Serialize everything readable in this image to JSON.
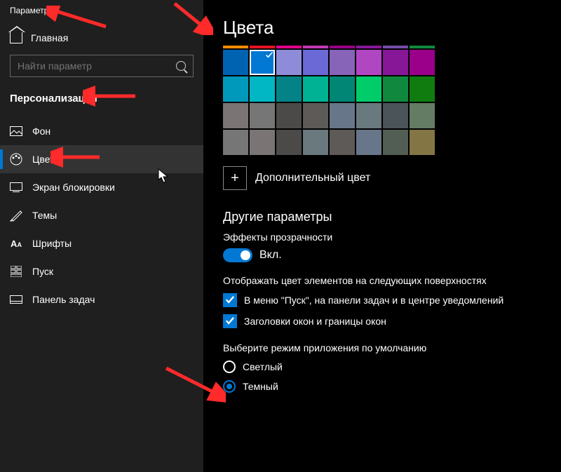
{
  "window_title": "Параметры",
  "home_label": "Главная",
  "search": {
    "placeholder": "Найти параметр"
  },
  "section_title": "Персонализация",
  "nav": [
    {
      "label": "Фон",
      "icon": "background"
    },
    {
      "label": "Цвета",
      "icon": "colors",
      "selected": true
    },
    {
      "label": "Экран блокировки",
      "icon": "lockscreen"
    },
    {
      "label": "Темы",
      "icon": "themes"
    },
    {
      "label": "Шрифты",
      "icon": "fonts"
    },
    {
      "label": "Пуск",
      "icon": "start"
    },
    {
      "label": "Панель задач",
      "icon": "taskbar"
    }
  ],
  "page_title": "Цвета",
  "recent_colors": [
    "#ff8c00",
    "#e81123",
    "#e3008c",
    "#c239b3",
    "#9a0089",
    "#881798",
    "#744da9",
    "#10893e"
  ],
  "color_palette": [
    [
      "#0063b1",
      "#0078d4",
      "#8e8cd8",
      "#6b69d6",
      "#8764b8",
      "#b146c2",
      "#881798",
      "#9a0089"
    ],
    [
      "#0099bc",
      "#00b7c3",
      "#038387",
      "#00b294",
      "#018574",
      "#00cc6a",
      "#10893e",
      "#107c10"
    ],
    [
      "#7a7574",
      "#767676",
      "#4c4a48",
      "#5d5a58",
      "#68768a",
      "#69797e",
      "#4a5459",
      "#647c64"
    ],
    [
      "#767676",
      "#7a7574",
      "#4c4a48",
      "#69797e",
      "#5d5a58",
      "#68768a",
      "#525e54",
      "#847545"
    ]
  ],
  "selected_color": {
    "row": 0,
    "col": 1
  },
  "custom_color_label": "Дополнительный цвет",
  "more_options_heading": "Другие параметры",
  "transparency": {
    "label": "Эффекты прозрачности",
    "state": "Вкл."
  },
  "surface_label": "Отображать цвет элементов на следующих поверхностях",
  "surface_checks": [
    {
      "label": "В меню \"Пуск\", на панели задач и в центре уведомлений",
      "checked": true
    },
    {
      "label": "Заголовки окон и границы окон",
      "checked": true
    }
  ],
  "mode_label": "Выберите режим приложения по умолчанию",
  "modes": [
    {
      "label": "Светлый",
      "checked": false
    },
    {
      "label": "Темный",
      "checked": true
    }
  ]
}
